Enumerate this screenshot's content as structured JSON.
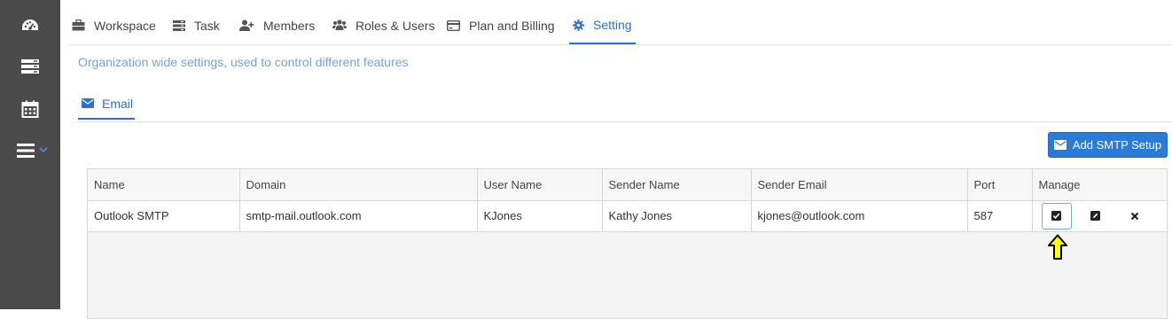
{
  "sidebar": {
    "items": [
      {
        "icon": "dashboard-icon"
      },
      {
        "icon": "server-icon"
      },
      {
        "icon": "calendar-icon"
      },
      {
        "icon": "menu-icon"
      }
    ]
  },
  "tabs": [
    {
      "label": "Workspace",
      "icon": "briefcase-icon"
    },
    {
      "label": "Task",
      "icon": "task-list-icon"
    },
    {
      "label": "Members",
      "icon": "user-plus-icon"
    },
    {
      "label": "Roles & Users",
      "icon": "users-icon"
    },
    {
      "label": "Plan and Billing",
      "icon": "credit-card-icon"
    },
    {
      "label": "Setting",
      "icon": "gear-icon",
      "active": true
    }
  ],
  "subtitle": "Organization wide settings, used to control different features",
  "subtabs": [
    {
      "label": "Email",
      "icon": "envelope-icon",
      "active": true
    }
  ],
  "add_button": {
    "label": "Add SMTP Setup",
    "icon": "envelope-icon"
  },
  "table": {
    "headers": [
      "Name",
      "Domain",
      "User Name",
      "Sender Name",
      "Sender Email",
      "Port",
      "Manage"
    ],
    "rows": [
      {
        "name": "Outlook SMTP",
        "domain": "smtp-mail.outlook.com",
        "user_name": "KJones",
        "sender_name": "Kathy Jones",
        "sender_email": "kjones@outlook.com",
        "port": "587"
      }
    ]
  },
  "colors": {
    "accent": "#2f6fd1",
    "sidebar": "#4a4a4a",
    "button": "#2b7bd6",
    "arrow": "#ffff00"
  }
}
